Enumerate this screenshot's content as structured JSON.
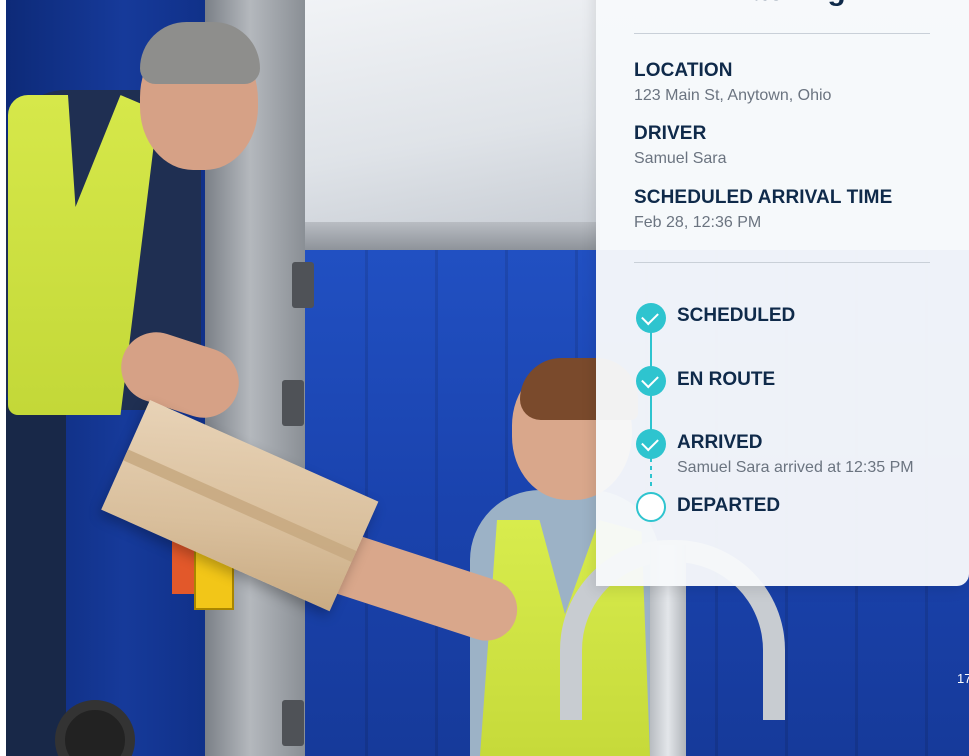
{
  "card": {
    "title": "Tracking",
    "info": [
      {
        "label": "LOCATION",
        "value": "123 Main St, Anytown, Ohio"
      },
      {
        "label": "DRIVER",
        "value": "Samuel Sara"
      },
      {
        "label": "SCHEDULED ARRIVAL TIME",
        "value": "Feb 28, 12:36 PM"
      }
    ],
    "steps": [
      {
        "label": "SCHEDULED",
        "status": "done"
      },
      {
        "label": "EN ROUTE",
        "status": "done"
      },
      {
        "label": "ARRIVED",
        "status": "done",
        "detail": "Samuel Sara arrived at 12:35 PM"
      },
      {
        "label": "DEPARTED",
        "status": "pending"
      }
    ]
  },
  "page": {
    "number": "17"
  },
  "colors": {
    "accent": "#2ec4cf",
    "heading": "#0f2a4a",
    "muted": "#6b7480"
  },
  "icons": [
    "check-circle-icon",
    "empty-circle-icon"
  ]
}
